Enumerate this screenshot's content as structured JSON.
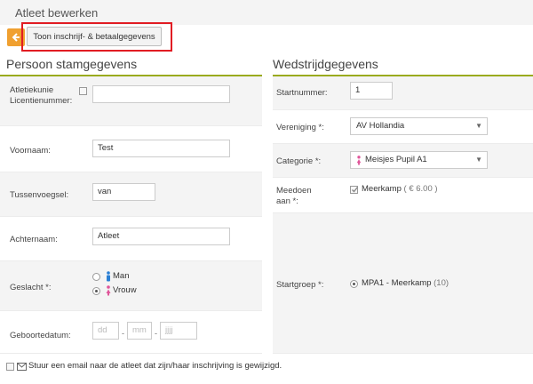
{
  "header": {
    "title": "Atleet bewerken"
  },
  "toolbar": {
    "back_icon": "arrow-left-icon",
    "toggle_label": "Toon inschrijf- & betaalgegevens",
    "accent": "#f0a030",
    "highlight": "#e11c23"
  },
  "person": {
    "title": "Persoon stamgegevens",
    "license_label": "Atletiekunie Licentienummer:",
    "license_value": "",
    "firstname_label": "Voornaam:",
    "firstname_value": "Test",
    "prefix_label": "Tussenvoegsel:",
    "prefix_value": "van",
    "lastname_label": "Achternaam:",
    "lastname_value": "Atleet",
    "gender_label": "Geslacht *:",
    "gender_options": [
      {
        "label": "Man",
        "selected": false,
        "icon": "male-icon",
        "color": "#2a7fd4"
      },
      {
        "label": "Vrouw",
        "selected": true,
        "icon": "female-icon",
        "color": "#e0559a"
      }
    ],
    "birthdate_label": "Geboortedatum:",
    "birth_day_placeholder": "dd",
    "birth_month_placeholder": "mm",
    "birth_year_placeholder": "jjjj",
    "separator": "-"
  },
  "competition": {
    "title": "Wedstrijdgegevens",
    "startnumber_label": "Startnummer:",
    "startnumber_value": "1",
    "club_label": "Vereniging *:",
    "club_value": "AV Hollandia",
    "category_label": "Categorie *:",
    "category_value": "Meisjes Pupil A1",
    "participate_label": "Meedoen aan *:",
    "event_name": "Meerkamp",
    "event_price": "( € 6.00 )",
    "startgroup_label": "Startgroep *:",
    "startgroup_name": "MPA1 - Meerkamp",
    "startgroup_count": "(10)"
  },
  "footer": {
    "email_label": "Stuur een email naar de atleet dat zijn/haar inschrijving is gewijzigd.",
    "email_icon": "envelope-icon"
  },
  "colors": {
    "section_line": "#9aab1e",
    "row_alt": "#f4f4f4"
  }
}
